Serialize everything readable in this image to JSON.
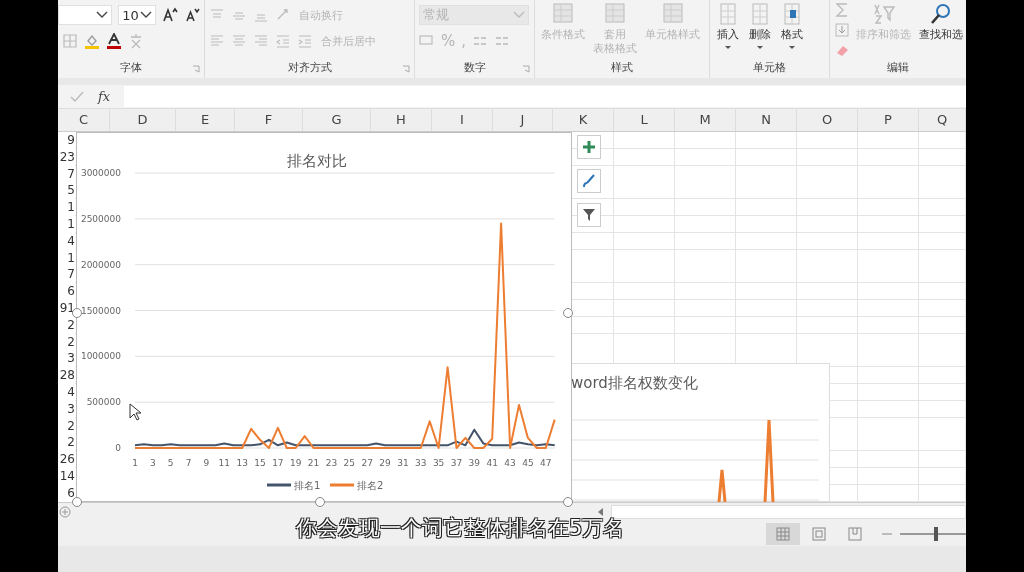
{
  "ribbon": {
    "font": {
      "label": "字体",
      "size": "10"
    },
    "alignment": {
      "label": "对齐方式",
      "wrap_text": {
        "label": "自动换行",
        "disabled": true
      },
      "merge": {
        "label": "合并后居中",
        "disabled": true
      }
    },
    "number": {
      "label": "数字",
      "format": {
        "value": "常规",
        "disabled": true
      },
      "percent": "%",
      "comma": ","
    },
    "styles": {
      "label": "样式",
      "buttons": [
        {
          "lines": [
            "条件格式"
          ],
          "disabled": true
        },
        {
          "lines": [
            "套用",
            "表格格式"
          ],
          "disabled": true
        },
        {
          "lines": [
            "单元格样式"
          ],
          "disabled": true
        }
      ]
    },
    "cells": {
      "label": "单元格",
      "buttons": [
        {
          "lines": [
            "插入"
          ],
          "disabled": false
        },
        {
          "lines": [
            "删除"
          ],
          "disabled": false
        },
        {
          "lines": [
            "格式"
          ],
          "disabled": false
        }
      ]
    },
    "editing": {
      "label": "编辑",
      "buttons": [
        {
          "lines": [
            "排序和筛选"
          ],
          "disabled": true
        },
        {
          "lines": [
            "查找和选"
          ],
          "disabled": false
        }
      ]
    }
  },
  "formula_bar": {
    "fx": "fx"
  },
  "columns": [
    "C",
    "D",
    "E",
    "F",
    "G",
    "H",
    "I",
    "J",
    "K",
    "L",
    "M",
    "N",
    "O",
    "P",
    "Q"
  ],
  "cut_cells": [
    "9",
    "23",
    "7",
    "5",
    "1",
    "1",
    "4",
    "1",
    "7",
    "6",
    "91",
    "2",
    "2",
    "3",
    "28",
    "4",
    "3",
    "2",
    "2",
    "26",
    "14",
    "6"
  ],
  "chart": {
    "selected": true,
    "chart_data": {
      "type": "line",
      "title": "排名对比",
      "grid": true,
      "legend": "bottom",
      "xlim": [
        1,
        48
      ],
      "x": [
        1,
        2,
        3,
        4,
        5,
        6,
        7,
        8,
        9,
        10,
        11,
        12,
        13,
        14,
        15,
        16,
        17,
        18,
        19,
        20,
        21,
        22,
        23,
        24,
        25,
        26,
        27,
        28,
        29,
        30,
        31,
        32,
        33,
        34,
        35,
        36,
        37,
        38,
        39,
        40,
        41,
        42,
        43,
        44,
        45,
        46,
        47,
        48
      ],
      "xticks": [
        {
          "value": 1,
          "label": "1"
        },
        {
          "value": 3,
          "label": "3"
        },
        {
          "value": 5,
          "label": "5"
        },
        {
          "value": 7,
          "label": "7"
        },
        {
          "value": 9,
          "label": "9"
        },
        {
          "value": 11,
          "label": "11"
        },
        {
          "value": 13,
          "label": "13"
        },
        {
          "value": 15,
          "label": "15"
        },
        {
          "value": 17,
          "label": "17"
        },
        {
          "value": 19,
          "label": "19"
        },
        {
          "value": 21,
          "label": "21"
        },
        {
          "value": 23,
          "label": "23"
        },
        {
          "value": 25,
          "label": "25"
        },
        {
          "value": 27,
          "label": "27"
        },
        {
          "value": 29,
          "label": "29"
        },
        {
          "value": 31,
          "label": "31"
        },
        {
          "value": 33,
          "label": "33"
        },
        {
          "value": 35,
          "label": "35"
        },
        {
          "value": 37,
          "label": "37"
        },
        {
          "value": 39,
          "label": "39"
        },
        {
          "value": 41,
          "label": "41"
        },
        {
          "value": 43,
          "label": "43"
        },
        {
          "value": 45,
          "label": "45"
        },
        {
          "value": 47,
          "label": "47"
        }
      ],
      "ylim": [
        0,
        3000000
      ],
      "yticks": [
        0,
        500000,
        1000000,
        1500000,
        2000000,
        2500000,
        3000000
      ],
      "series": [
        {
          "name": "排名1",
          "color": "#44546a",
          "values": [
            30000,
            40000,
            30000,
            30000,
            40000,
            30000,
            30000,
            30000,
            30000,
            30000,
            50000,
            30000,
            30000,
            30000,
            40000,
            90000,
            30000,
            60000,
            30000,
            30000,
            30000,
            30000,
            30000,
            30000,
            30000,
            30000,
            30000,
            50000,
            30000,
            30000,
            30000,
            30000,
            30000,
            30000,
            30000,
            30000,
            70000,
            30000,
            200000,
            50000,
            30000,
            30000,
            30000,
            60000,
            40000,
            30000,
            40000,
            30000
          ]
        },
        {
          "name": "排名2",
          "color": "#ed7d31",
          "values": [
            0,
            0,
            0,
            0,
            0,
            0,
            0,
            0,
            0,
            0,
            0,
            0,
            0,
            210000,
            90000,
            0,
            220000,
            0,
            0,
            130000,
            0,
            0,
            0,
            0,
            0,
            0,
            0,
            0,
            0,
            0,
            0,
            0,
            0,
            290000,
            0,
            880000,
            0,
            110000,
            0,
            0,
            100000,
            2450000,
            0,
            470000,
            110000,
            0,
            0,
            310000
          ]
        }
      ]
    }
  },
  "chart2": {
    "title": "word排名权数变化"
  },
  "status_bar": {
    "views": [
      {
        "selected": true
      },
      {
        "selected": false
      },
      {
        "selected": false
      }
    ],
    "zoom": {
      "level": 0.55
    }
  },
  "subtitle": "你会发现一个词它整体排名在5万名"
}
